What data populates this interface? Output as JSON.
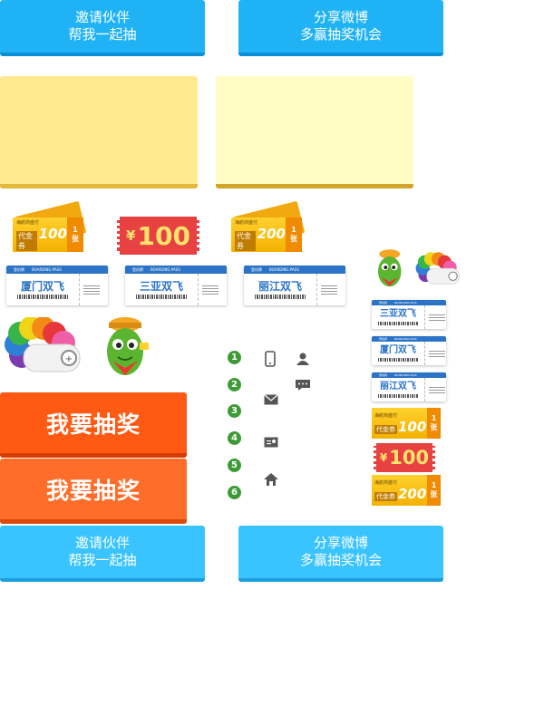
{
  "buttons_top": [
    {
      "line1": "邀请伙伴",
      "line2": "帮我一起抽"
    },
    {
      "line1": "分享微博",
      "line2": "多赢抽奖机会"
    }
  ],
  "buttons_bottom": [
    {
      "line1": "邀请伙伴",
      "line2": "帮我一起抽"
    },
    {
      "line1": "分享微博",
      "line2": "多赢抽奖机会"
    }
  ],
  "coupons": {
    "small_text": "海航商盛付",
    "label": "代金券",
    "currency": "¥",
    "amount_100": "100",
    "amount_200": "200",
    "count_num": "1",
    "count_unit": "张"
  },
  "red_ticket": {
    "currency": "¥",
    "amount": "100"
  },
  "boarding_pass": {
    "header_left": "登机牌",
    "header_mid": "BOARDING PASS",
    "header_right": "登机牌",
    "routes": [
      "厦门双飞",
      "三亚双飞",
      "丽江双飞"
    ]
  },
  "right_passes": [
    "三亚双飞",
    "厦门双飞",
    "丽江双飞"
  ],
  "draw_button": "我要抽奖",
  "draw_button_2": "我要抽奖",
  "steps": [
    "1",
    "2",
    "3",
    "4",
    "5",
    "6"
  ],
  "icons": [
    "phone-icon",
    "user-icon",
    "chat-icon",
    "mail-icon",
    "id-card-icon",
    "home-icon"
  ],
  "colors": {
    "blue_button": "#1fb3f5",
    "orange_button": "#ff5a14",
    "step_badge": "#3d9b35",
    "red_ticket": "#e74141",
    "coupon_yellow": "#ffd12e"
  }
}
